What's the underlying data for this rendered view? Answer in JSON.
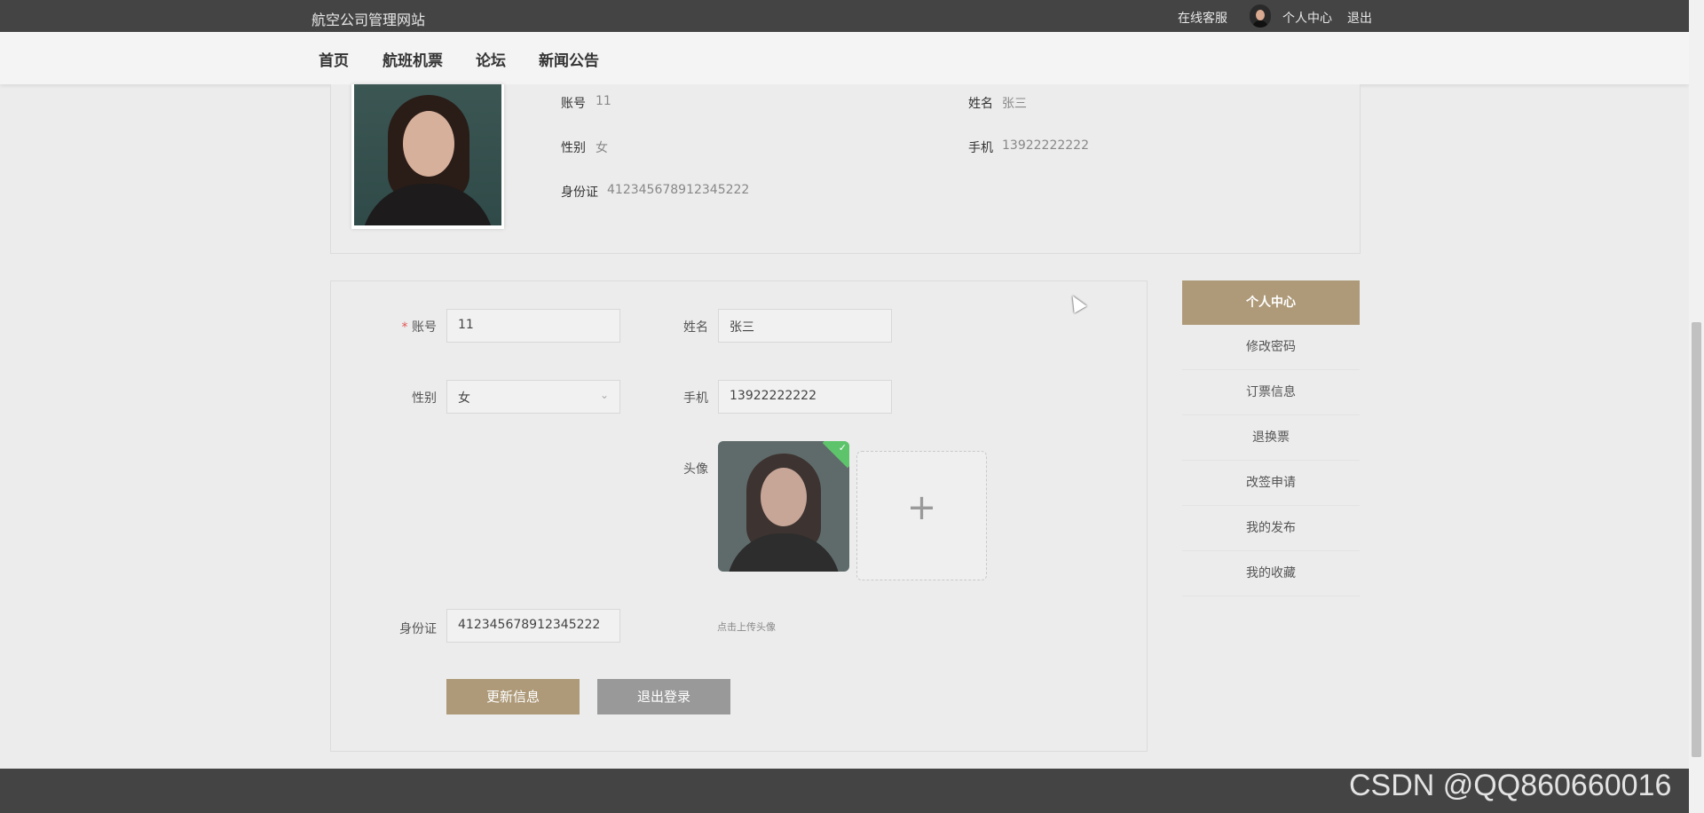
{
  "topbar": {
    "site_title": "航空公司管理网站",
    "online_service": "在线客服",
    "personal_center": "个人中心",
    "logout": "退出"
  },
  "nav": {
    "items": [
      "首页",
      "航班机票",
      "论坛",
      "新闻公告"
    ]
  },
  "profile": {
    "account_label": "账号",
    "account_value": "11",
    "name_label": "姓名",
    "name_value": "张三",
    "gender_label": "性别",
    "gender_value": "女",
    "phone_label": "手机",
    "phone_value": "13922222222",
    "id_label": "身份证",
    "id_value": "412345678912345222"
  },
  "form": {
    "required_mark": "*",
    "account_label": "账号",
    "account_value": "11",
    "name_label": "姓名",
    "name_value": "张三",
    "gender_label": "性别",
    "gender_value": "女",
    "phone_label": "手机",
    "phone_value": "13922222222",
    "avatar_label": "头像",
    "id_label": "身份证",
    "id_value": "412345678912345222",
    "upload_hint": "点击上传头像",
    "update_button": "更新信息",
    "logout_button": "退出登录"
  },
  "sidebar": {
    "header": "个人中心",
    "items": [
      "修改密码",
      "订票信息",
      "退换票",
      "改签申请",
      "我的发布",
      "我的收藏"
    ]
  },
  "watermark": "CSDN @QQ860660016",
  "colors": {
    "topbar": "#444444",
    "accent": "#ae9a79",
    "secondary_button": "#999999",
    "success": "#5ec46b"
  }
}
